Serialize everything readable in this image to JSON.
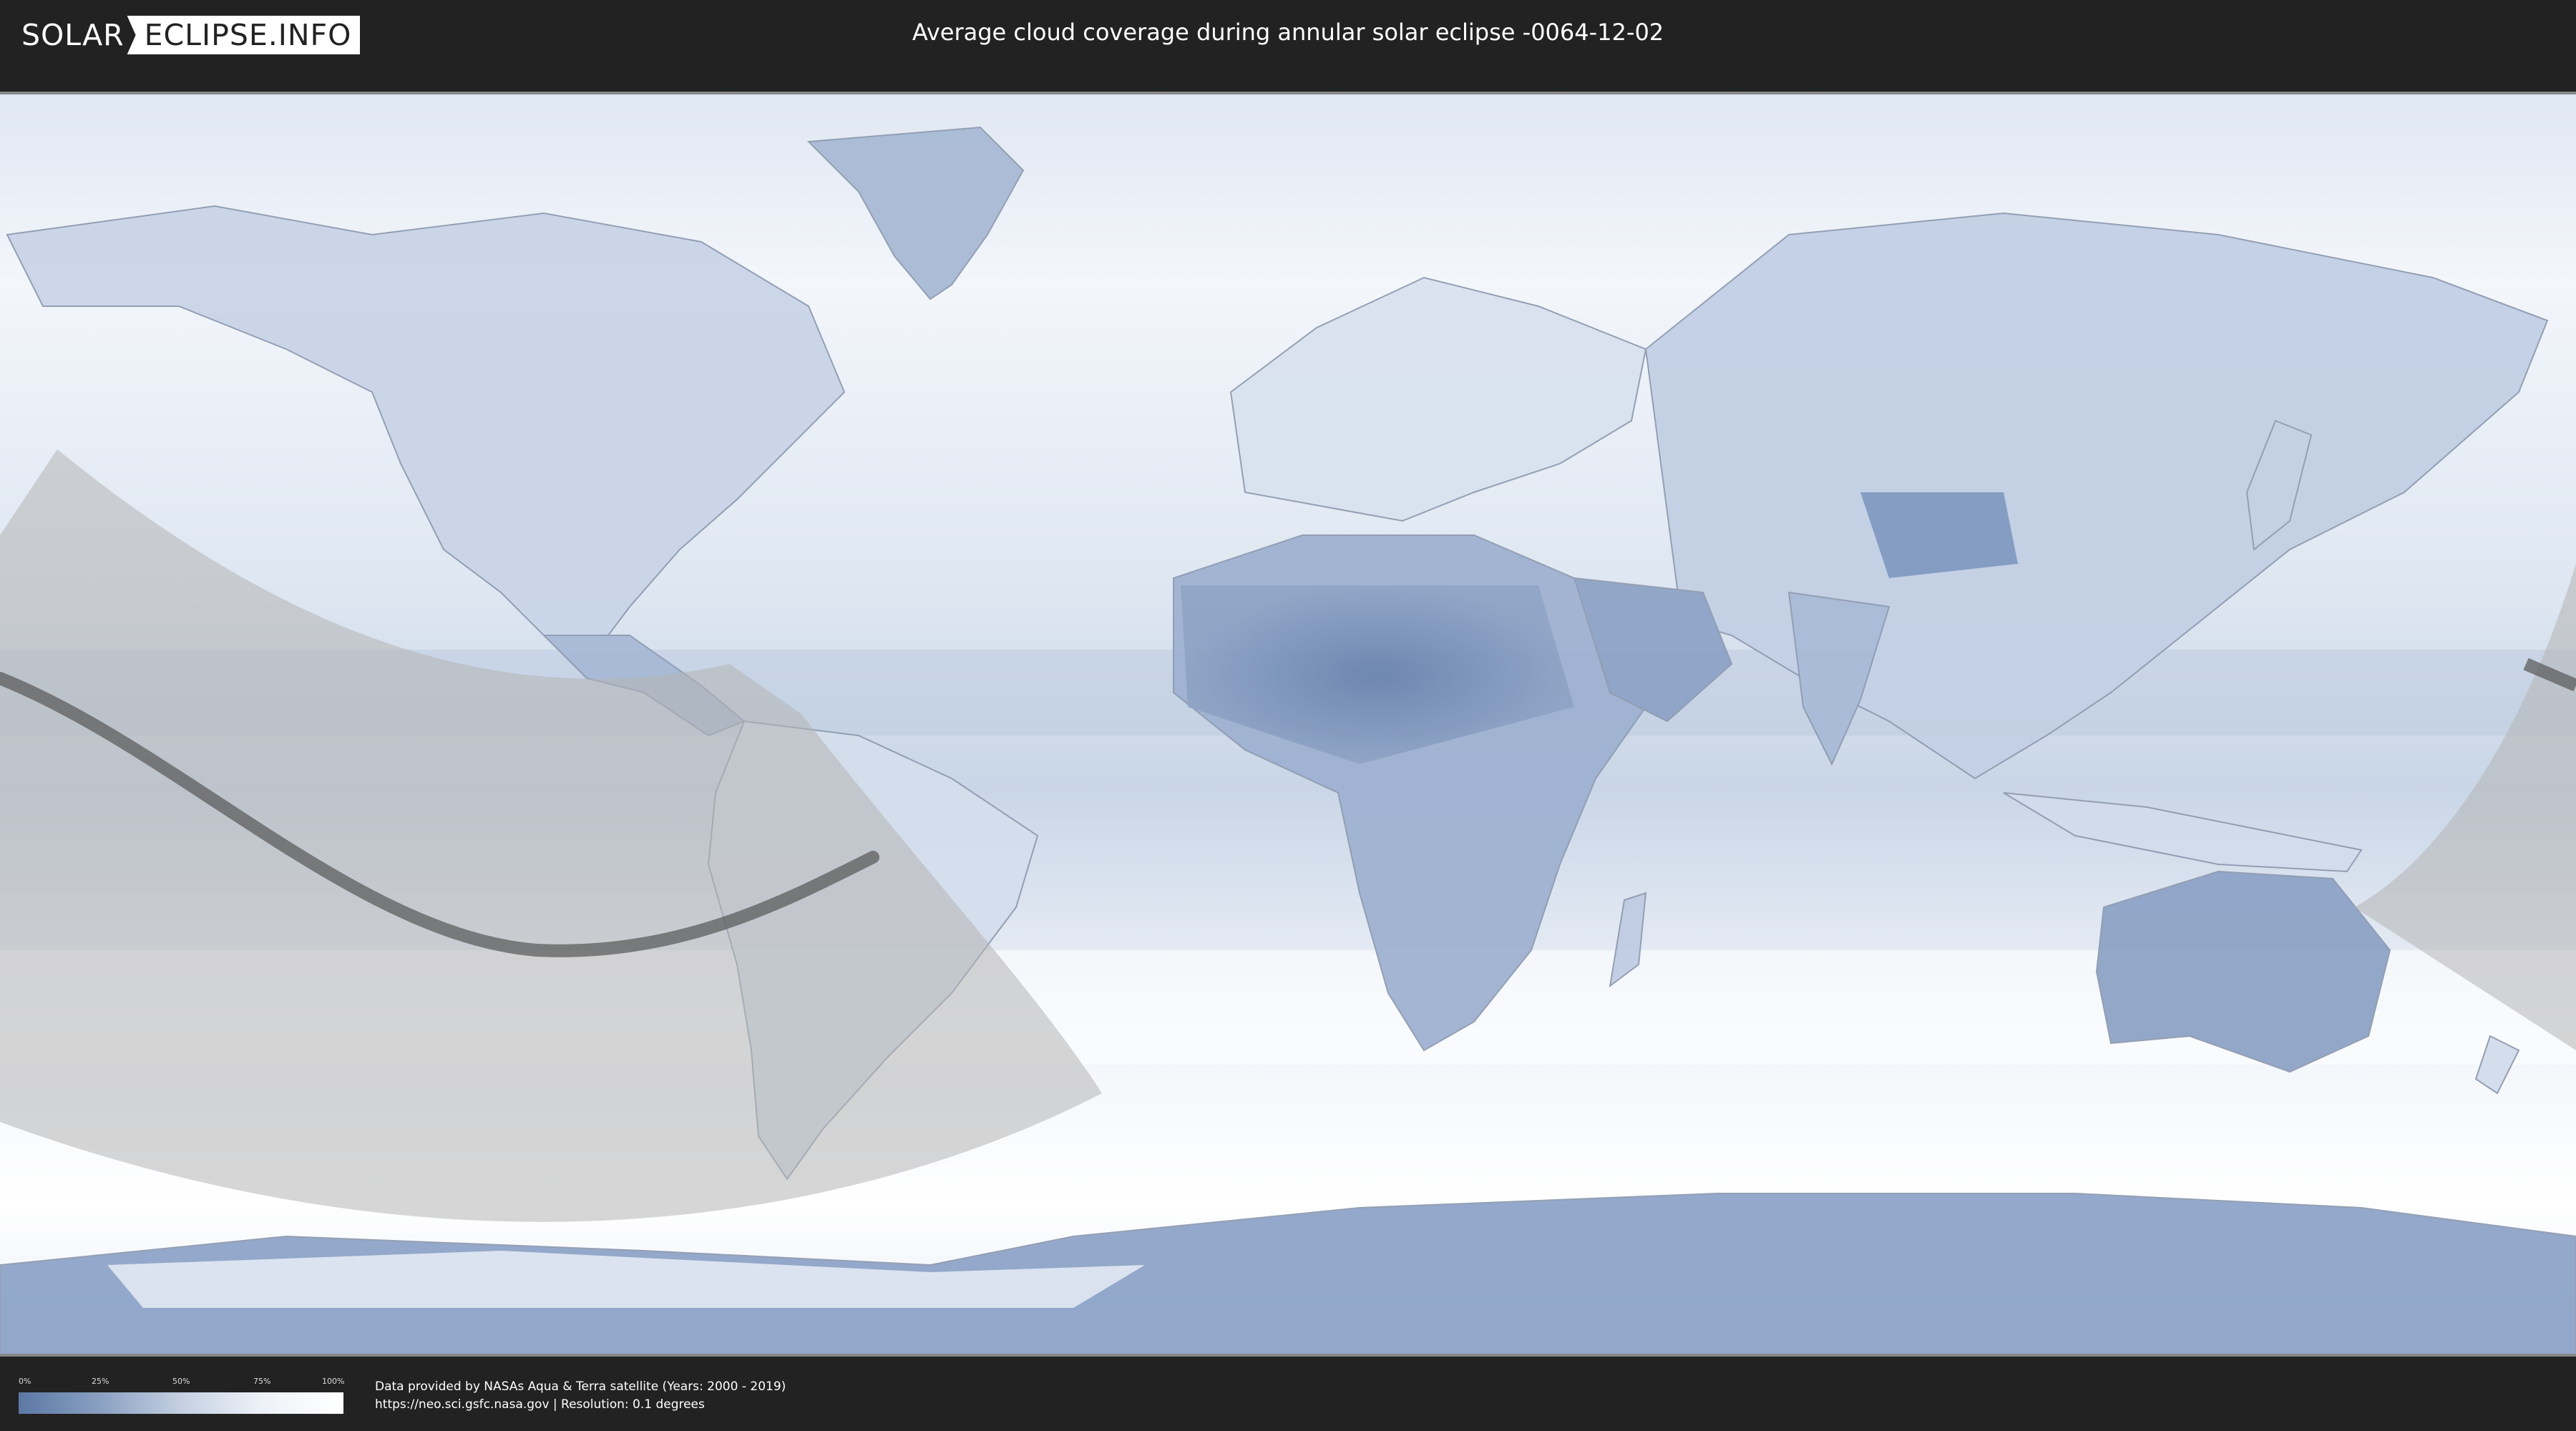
{
  "header": {
    "logo_left": "SOLAR",
    "logo_right": "ECLIPSE.INFO",
    "title": "Average cloud coverage during annular solar eclipse -0064-12-02"
  },
  "legend": {
    "ticks": [
      "0%",
      "25%",
      "50%",
      "75%",
      "100%"
    ],
    "colors": [
      "#5b78a4",
      "#8aa0c2",
      "#c4d0e2",
      "#eef2f8",
      "#ffffff"
    ]
  },
  "credits": {
    "line1": "Data provided by NASAs Aqua & Terra satellite (Years: 2000 - 2019)",
    "line2": "https://neo.sci.gsfc.nasa.gov | Resolution: 0.1 degrees"
  },
  "map": {
    "icons": [
      "world-map",
      "eclipse-shadow-band",
      "central-eclipse-line"
    ],
    "colors": {
      "ocean_clouds": "#eef3f9",
      "land_low_cloud": "#6f89b3",
      "eclipse_band": "#b9b9b9",
      "central_line": "#555555",
      "border": "#8f9bb0"
    }
  }
}
